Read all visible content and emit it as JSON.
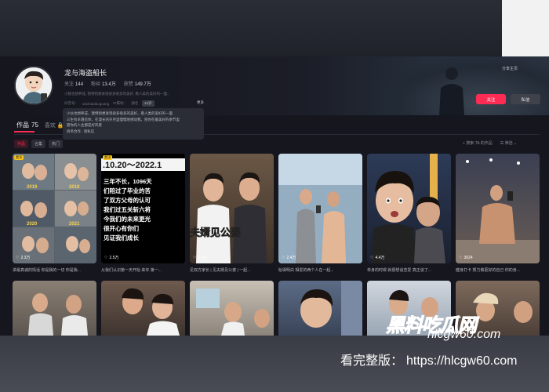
{
  "profile": {
    "name": "龙与海盗船长",
    "stats": [
      {
        "label": "关注",
        "value": "144"
      },
      {
        "label": "粉丝",
        "value": "13.4万"
      },
      {
        "label": "获赞",
        "value": "149.7万"
      }
    ],
    "bio_line": "小猪也想养成, 我特别想发现很多很多的美好, 看人类的美好的一面...",
    "id_label": "抖音号：",
    "id_value": "xiaohaidaoguang",
    "ip_label": "IP属地：",
    "ip_value": "湖北",
    "age_badge": "24岁",
    "more": "更多",
    "share": "分享主页",
    "follow": "关注",
    "message": "私信"
  },
  "tooltip": {
    "lines": [
      "小伙也想养成，我特别想发现很多很多的美好，看人类的美好的一面",
      "三生有幸遇见你，在漫长的岁月里慢慢地感动我，陪你在最美好的季节里",
      "愿你的人生都是好风景",
      "商务合作 : 请私信"
    ]
  },
  "tabs": {
    "works_label": "作品",
    "works_count": "75",
    "likes_label": "喜欢"
  },
  "chips": [
    "作品",
    "合集",
    "热门"
  ],
  "tools": {
    "search": "搜索 TA 的作品",
    "sort": "筛选"
  },
  "videos": [
    {
      "likes": "2.3万",
      "caption": "讲最真诚的情话 你是我的一切 你是我...",
      "pinned": true,
      "pin_label": "置顶"
    },
    {
      "likes": "2.5万",
      "caption": "从我们认识第一天开始 来年 第一...",
      "pinned": true,
      "pin_label": "置顶",
      "title_text": ".10.20～2022.1",
      "body_text": "三年不长，1096天\n们陪过了毕业的苦\n了双方父母的认可\n我们过五关斩六将\n今我们的未来更光\n很开心有你们\n见证我们成长"
    },
    {
      "likes": "1.6万",
      "caption": "见双方家长 | 见夫婿见公婆 | 一起...",
      "pinned": false,
      "overlay_text": "夫婿见公婆"
    },
    {
      "likes": "2.4万",
      "caption": "始得明白 相爱的两个人在一起...",
      "pinned": false
    },
    {
      "likes": "4.4万",
      "caption": "单身的时候 就很想谈恋爱 真正谈了...",
      "pinned": false
    },
    {
      "likes": "3024",
      "caption": "健身打卡 努力做更好的自己 你的身...",
      "pinned": false
    }
  ],
  "watermark": {
    "logo": "黑料吃瓜网",
    "url": "hlcgw60.com",
    "full_label": "看完整版：",
    "full_url": "https://hlcgw60.com"
  },
  "colors": {
    "accent": "#fe2c55",
    "background": "#15161e",
    "watermark_blue": "#2a86ff"
  }
}
